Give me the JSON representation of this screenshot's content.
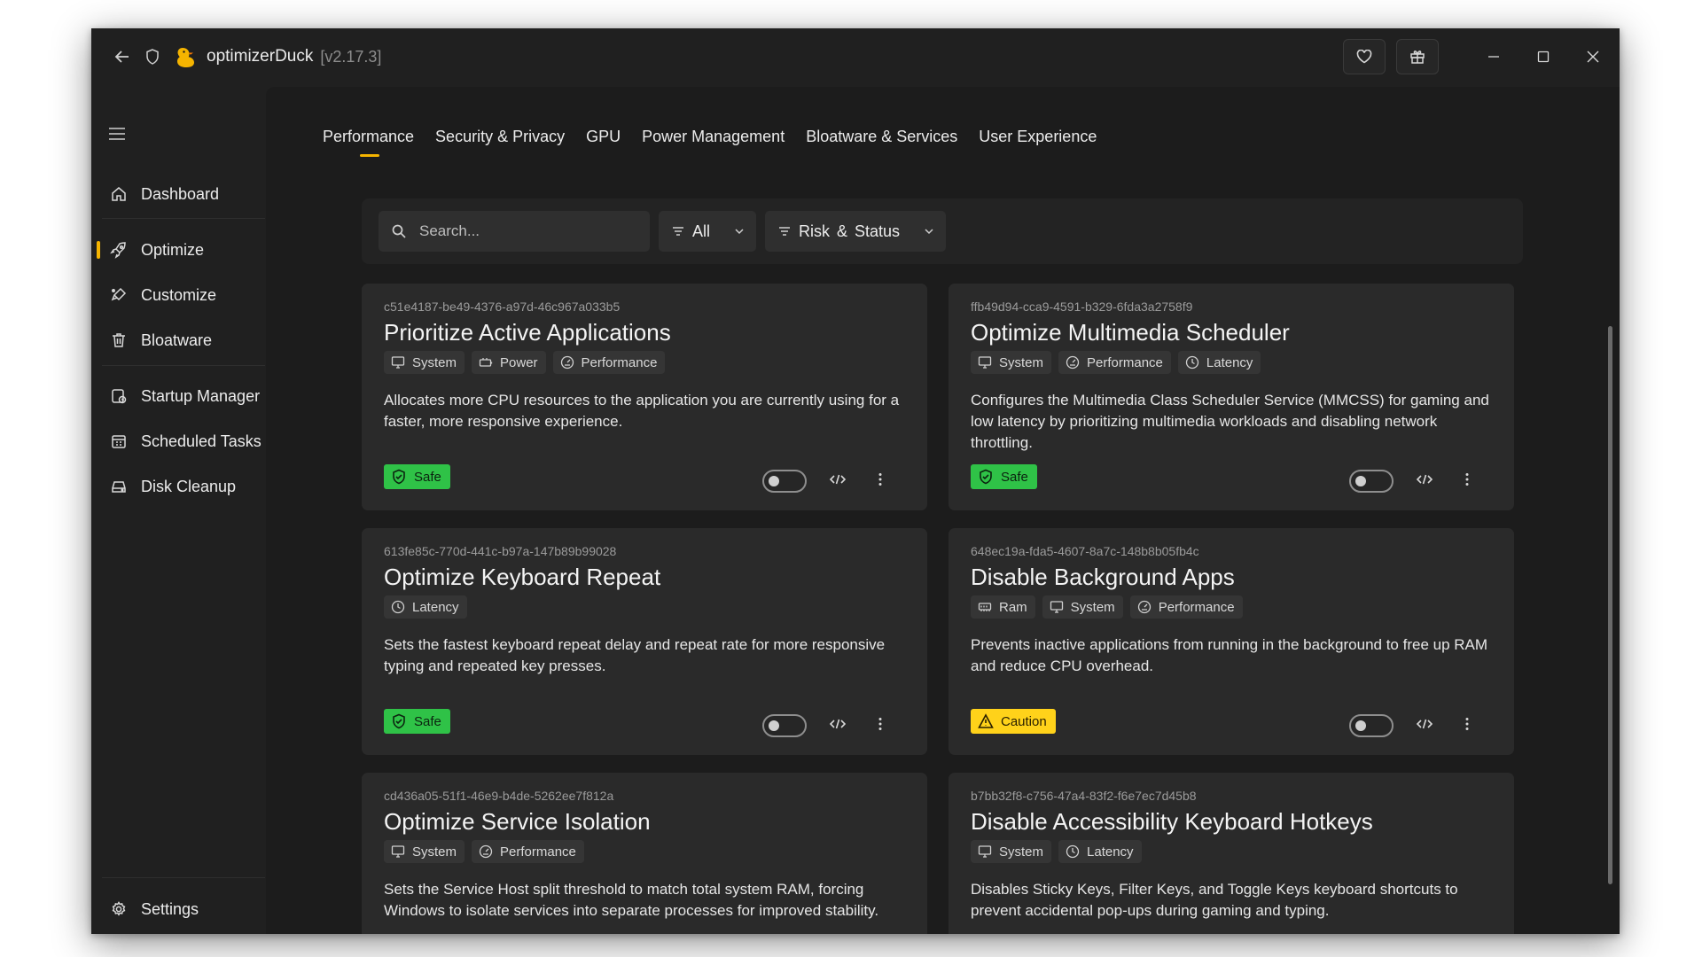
{
  "app": {
    "name": "optimizerDuck",
    "version": "[v2.17.3]"
  },
  "sidebar": {
    "items": [
      {
        "label": "Dashboard",
        "icon": "home-icon"
      },
      {
        "label": "Optimize",
        "icon": "rocket-icon",
        "active": true
      },
      {
        "label": "Customize",
        "icon": "paint-icon"
      },
      {
        "label": "Bloatware",
        "icon": "trash-icon"
      },
      {
        "label": "Startup Manager",
        "icon": "startup-icon"
      },
      {
        "label": "Scheduled Tasks",
        "icon": "calendar-icon"
      },
      {
        "label": "Disk Cleanup",
        "icon": "disk-icon"
      }
    ],
    "settings_label": "Settings"
  },
  "tabs": [
    {
      "label": "Performance",
      "active": true
    },
    {
      "label": "Security & Privacy"
    },
    {
      "label": "GPU"
    },
    {
      "label": "Power Management"
    },
    {
      "label": "Bloatware & Services"
    },
    {
      "label": "User Experience"
    }
  ],
  "filters": {
    "search_placeholder": "Search...",
    "category_label": "All",
    "risk_label": "Risk & Status"
  },
  "colors": {
    "accent": "#f5b400",
    "safe": "#2fc247",
    "caution": "#ffd21a"
  },
  "cards": [
    {
      "id": "c51e4187-be49-4376-a97d-46c967a033b5",
      "title": "Prioritize Active Applications",
      "tags": [
        "System",
        "Power",
        "Performance"
      ],
      "description": "Allocates more CPU resources to the application you are currently using for a faster, more responsive experience.",
      "risk": "Safe",
      "enabled": false
    },
    {
      "id": "ffb49d94-cca9-4591-b329-6fda3a2758f9",
      "title": "Optimize Multimedia Scheduler",
      "tags": [
        "System",
        "Performance",
        "Latency"
      ],
      "description": "Configures the Multimedia Class Scheduler Service (MMCSS) for gaming and low latency by prioritizing multimedia workloads and disabling network throttling.",
      "risk": "Safe",
      "enabled": false
    },
    {
      "id": "613fe85c-770d-441c-b97a-147b89b99028",
      "title": "Optimize Keyboard Repeat",
      "tags": [
        "Latency"
      ],
      "description": "Sets the fastest keyboard repeat delay and repeat rate for more responsive typing and repeated key presses.",
      "risk": "Safe",
      "enabled": false
    },
    {
      "id": "648ec19a-fda5-4607-8a7c-148b8b05fb4c",
      "title": "Disable Background Apps",
      "tags": [
        "Ram",
        "System",
        "Performance"
      ],
      "description": "Prevents inactive applications from running in the background to free up RAM and reduce CPU overhead.",
      "risk": "Caution",
      "enabled": false
    },
    {
      "id": "cd436a05-51f1-46e9-b4de-5262ee7f812a",
      "title": "Optimize Service Isolation",
      "tags": [
        "System",
        "Performance"
      ],
      "description": "Sets the Service Host split threshold to match total system RAM, forcing Windows to isolate services into separate processes for improved stability.",
      "risk": "",
      "enabled": false
    },
    {
      "id": "b7bb32f8-c756-47a4-83f2-f6e7ec7d45b8",
      "title": "Disable Accessibility Keyboard Hotkeys",
      "tags": [
        "System",
        "Latency"
      ],
      "description": "Disables Sticky Keys, Filter Keys, and Toggle Keys keyboard shortcuts to prevent accidental pop-ups during gaming and typing.",
      "risk": "",
      "enabled": false
    }
  ]
}
